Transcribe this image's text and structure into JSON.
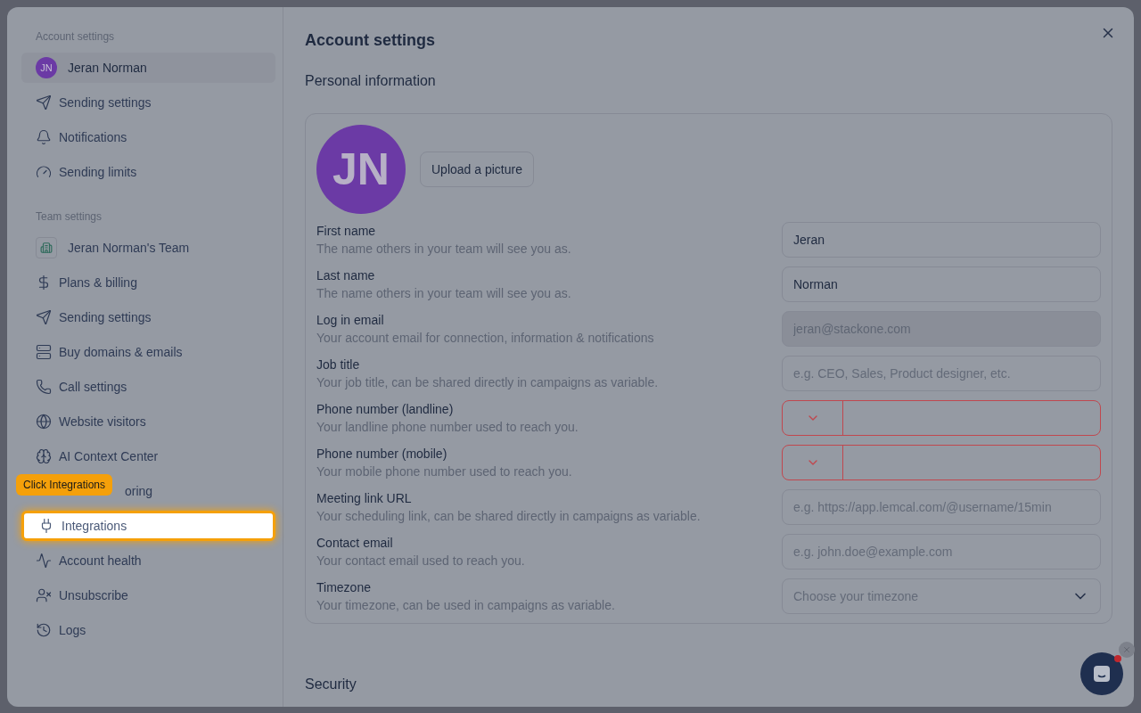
{
  "sidebar": {
    "sections": [
      {
        "title": "Account settings",
        "items": [
          {
            "kind": "avatar",
            "initials": "JN",
            "label": "Jeran Norman",
            "selected": true,
            "highlighted": false
          },
          {
            "kind": "icon",
            "label": "Sending settings",
            "selected": false,
            "highlighted": false
          },
          {
            "kind": "icon",
            "label": "Notifications",
            "selected": false,
            "highlighted": false
          },
          {
            "kind": "icon",
            "label": "Sending limits",
            "selected": false,
            "highlighted": false
          }
        ]
      },
      {
        "title": "Team settings",
        "items": [
          {
            "kind": "team",
            "label": "Jeran Norman's Team",
            "selected": false,
            "highlighted": false
          },
          {
            "kind": "icon",
            "label": "Plans & billing",
            "selected": false,
            "highlighted": false
          },
          {
            "kind": "icon",
            "label": "Sending settings",
            "selected": false,
            "highlighted": false
          },
          {
            "kind": "icon",
            "label": "Buy domains & emails",
            "selected": false,
            "highlighted": false
          },
          {
            "kind": "icon",
            "label": "Call settings",
            "selected": false,
            "highlighted": false
          },
          {
            "kind": "icon",
            "label": "Website visitors",
            "selected": false,
            "highlighted": false
          },
          {
            "kind": "icon",
            "label": "AI Context Center",
            "selected": false,
            "highlighted": false
          },
          {
            "kind": "covered",
            "label": "oring",
            "tooltip": "Click Integrations",
            "selected": false,
            "highlighted": false
          },
          {
            "kind": "icon",
            "label": "Integrations",
            "selected": false,
            "highlighted": true
          },
          {
            "kind": "icon",
            "label": "Account health",
            "selected": false,
            "highlighted": false
          },
          {
            "kind": "icon",
            "label": "Unsubscribe",
            "selected": false,
            "highlighted": false
          },
          {
            "kind": "icon",
            "label": "Logs",
            "selected": false,
            "highlighted": false
          }
        ]
      }
    ]
  },
  "main": {
    "title": "Account settings",
    "section": "Personal information",
    "profile": {
      "initials": "JN",
      "upload_button": "Upload a picture"
    },
    "fields": [
      {
        "kind": "text",
        "label": "First name",
        "hint": "The name others in your team will see you as.",
        "value": "Jeran"
      },
      {
        "kind": "text",
        "label": "Last name",
        "hint": "The name others in your team will see you as.",
        "value": "Norman"
      },
      {
        "kind": "disabled",
        "label": "Log in email",
        "hint": "Your account email for connection, information & notifications",
        "value": "jeran@stackone.com"
      },
      {
        "kind": "text",
        "label": "Job title",
        "hint": "Your job title, can be shared directly in campaigns as variable.",
        "placeholder": "e.g. CEO, Sales, Product designer, etc."
      },
      {
        "kind": "phone",
        "label": "Phone number (landline)",
        "hint": "Your landline phone number used to reach you.",
        "error": true
      },
      {
        "kind": "phone",
        "label": "Phone number (mobile)",
        "hint": "Your mobile phone number used to reach you.",
        "error": true
      },
      {
        "kind": "text",
        "label": "Meeting link URL",
        "hint": "Your scheduling link, can be shared directly in campaigns as variable.",
        "placeholder": "e.g. https://app.lemcal.com/@username/15min"
      },
      {
        "kind": "text",
        "label": "Contact email",
        "hint": "Your contact email used to reach you.",
        "placeholder": "e.g. john.doe@example.com"
      },
      {
        "kind": "select",
        "label": "Timezone",
        "hint": "Your timezone, can be used in campaigns as variable.",
        "placeholder": "Choose your timezone"
      }
    ],
    "next_section": "Security"
  },
  "chat": {
    "unread": true
  }
}
